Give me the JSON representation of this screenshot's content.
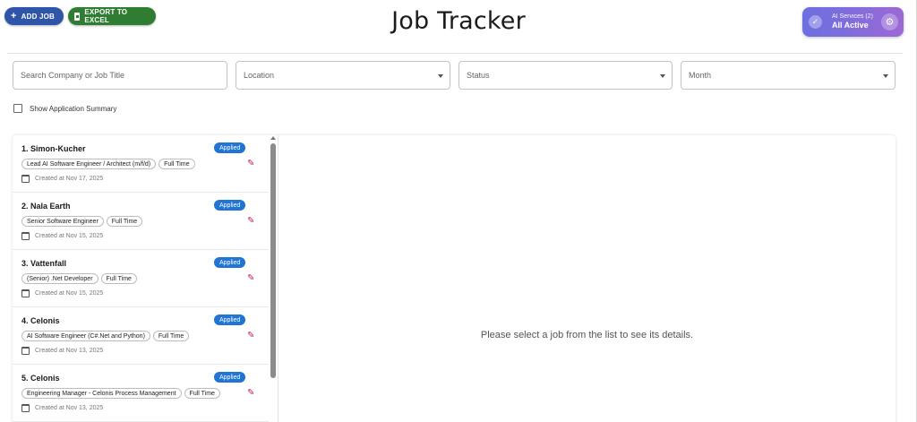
{
  "header": {
    "add_job_label": "ADD JOB",
    "export_label": "EXPORT TO EXCEL",
    "title": "Job Tracker",
    "ai_services_label": "AI Services (2)",
    "ai_status": "All Active"
  },
  "filters": {
    "search_placeholder": "Search Company or Job Title",
    "location_placeholder": "Location",
    "status_placeholder": "Status",
    "month_placeholder": "Month",
    "summary_label": "Show Application Summary",
    "summary_checked": false
  },
  "jobs": [
    {
      "name": "1. Simon-Kucher",
      "status": "Applied",
      "tags": [
        "Lead AI Software Engineer / Architect (m/f/d)",
        "Full Time"
      ],
      "created": "Created at Nov 17, 2025"
    },
    {
      "name": "2. Nala Earth",
      "status": "Applied",
      "tags": [
        "Senior Software Engineer",
        "Full Time"
      ],
      "created": "Created at Nov 15, 2025"
    },
    {
      "name": "3. Vattenfall",
      "status": "Applied",
      "tags": [
        "(Senior) .Net Developer",
        "Full Time"
      ],
      "created": "Created at Nov 15, 2025"
    },
    {
      "name": "4. Celonis",
      "status": "Applied",
      "tags": [
        "AI Software Engineer (C#.Net and Python)",
        "Full Time"
      ],
      "created": "Created at Nov 13, 2025"
    },
    {
      "name": "5. Celonis",
      "status": "Applied",
      "tags": [
        "Engineering Manager - Celonis Process Management",
        "Full Time"
      ],
      "created": "Created at Nov 13, 2025"
    }
  ],
  "details": {
    "placeholder": "Please select a job from the list to see its details."
  },
  "colors": {
    "add_button": "#2f55a8",
    "export_button": "#2e7d32",
    "status_badge": "#1f74d4",
    "edit_icon": "#c2185b",
    "ai_gradient_start": "#6b6fe0",
    "ai_gradient_end": "#9b69d6"
  },
  "icons": {
    "add": "plus-icon",
    "export": "excel-file-icon",
    "ai_status": "check-circle-icon",
    "ai_settings": "gear-icon",
    "edit": "pencil-icon",
    "created": "calendar-icon",
    "dropdown": "caret-down-icon"
  }
}
